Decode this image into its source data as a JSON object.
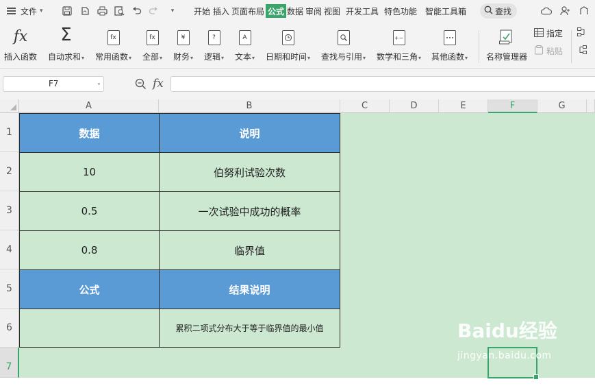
{
  "menubar": {
    "file_label": "文件",
    "tabs": [
      {
        "label": "开始"
      },
      {
        "label": "插入"
      },
      {
        "label": "页面布局"
      },
      {
        "label": "公式",
        "active": true
      },
      {
        "label": "数据"
      },
      {
        "label": "审阅"
      },
      {
        "label": "视图"
      },
      {
        "label": "开发工具"
      },
      {
        "label": "特色功能"
      },
      {
        "label": "智能工具箱"
      }
    ],
    "search_label": "查找",
    "active_tab_color": "#3aa56a"
  },
  "ribbon": {
    "insert_function": "插入函数",
    "autosum": "自动求和",
    "common_functions": "常用函数",
    "all": "全部",
    "finance": "财务",
    "logic": "逻辑",
    "text": "文本",
    "datetime": "日期和时间",
    "lookup": "查找与引用",
    "math": "数学和三角",
    "other": "其他函数",
    "name_manager": "名称管理器",
    "specify": "指定",
    "paste": "粘贴",
    "icons": {
      "fx_glyph": "fx",
      "sigma_glyph": "Σ",
      "finance_glyph": "¥",
      "logic_glyph": "?",
      "text_glyph": "A",
      "math_glyph": "+−"
    }
  },
  "formula_bar": {
    "cell_ref": "F7",
    "fx_label": "fx",
    "content": ""
  },
  "grid": {
    "columns": [
      "A",
      "B",
      "C",
      "D",
      "E",
      "F",
      "G"
    ],
    "rows": [
      "1",
      "2",
      "3",
      "4",
      "5",
      "6",
      "7"
    ],
    "selected_column": "F",
    "selected_row": "7",
    "cells": {
      "a1": "数据",
      "b1": "说明",
      "a2": "10",
      "b2": "伯努利试验次数",
      "a3": "0.5",
      "b3": "一次试验中成功的概率",
      "a4": "0.8",
      "b4": "临界值",
      "a5": "公式",
      "b5": "结果说明",
      "a6": "",
      "b6": "累积二项式分布大于等于临界值的最小值"
    },
    "header_fill": "#5b9bd5",
    "sheet_fill": "#cce8d1"
  },
  "watermark": {
    "brand": "Baidu经验",
    "url": "jingyan.baidu.com"
  }
}
